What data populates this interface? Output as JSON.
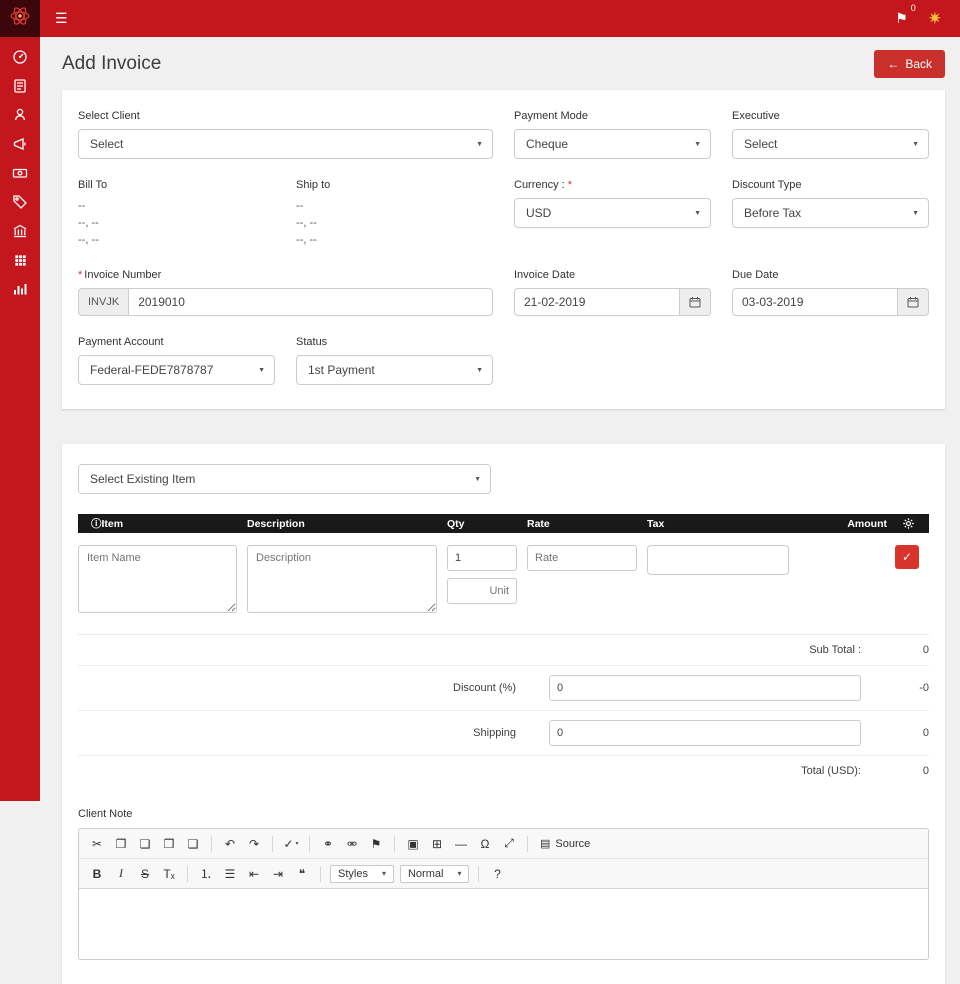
{
  "ui": {
    "caret": "▼"
  },
  "topbar": {
    "menu_icon": "☰",
    "flag_icon": "⚑",
    "flag_badge": "0",
    "star_icon": "✷"
  },
  "header": {
    "title": "Add Invoice",
    "back_arrow": "←",
    "back_label": "Back"
  },
  "invoice": {
    "required_mark": "*",
    "select_client_label": "Select Client",
    "select_client_value": "Select",
    "payment_mode_label": "Payment Mode",
    "payment_mode_value": "Cheque",
    "executive_label": "Executive",
    "executive_value": "Select",
    "bill_to_label": "Bill To",
    "bill_to_line1": "--",
    "bill_to_line2": "--, --",
    "bill_to_line3": "--, --",
    "ship_to_label": "Ship to",
    "ship_to_line1": "--",
    "ship_to_line2": "--, --",
    "ship_to_line3": "--, --",
    "currency_label": "Currency : ",
    "currency_value": "USD",
    "discount_type_label": "Discount Type",
    "discount_type_value": "Before Tax",
    "invoice_number_label": "Invoice Number",
    "invoice_number_prefix": "INVJK",
    "invoice_number_value": "2019010",
    "invoice_date_label": "Invoice Date",
    "invoice_date_value": "21-02-2019",
    "due_date_label": "Due Date",
    "due_date_value": "03-03-2019",
    "payment_account_label": "Payment Account",
    "payment_account_value": "Federal-FEDE7878787",
    "status_label": "Status",
    "status_value": "1st Payment"
  },
  "items": {
    "select_existing_value": "Select Existing Item",
    "info_icon": "ⓘ",
    "col_item": "Item",
    "col_description": "Description",
    "col_qty": "Qty",
    "col_rate": "Rate",
    "col_tax": "Tax",
    "col_amount": "Amount",
    "item_placeholder": "Item Name",
    "description_placeholder": "Description",
    "qty_value": "1",
    "unit_placeholder": "Unit",
    "rate_placeholder": "Rate",
    "add_check": "✓"
  },
  "totals": {
    "sub_total_label": "Sub Total :",
    "sub_total_value": "0",
    "discount_label": "Discount (%)",
    "discount_input": "0",
    "discount_value": "-0",
    "shipping_label": "Shipping",
    "shipping_input": "0",
    "shipping_value": "0",
    "total_label": "Total (USD):",
    "total_value": "0"
  },
  "note": {
    "label": "Client Note",
    "toolbar1": [
      "✂",
      "❐",
      "❏",
      "❒",
      "❑",
      "↶",
      "↷",
      "✓",
      "⚭",
      "⚮",
      "⚑",
      "▣",
      "⊞",
      "―",
      "Ω",
      "⤢"
    ],
    "caret": "▾",
    "source_icon": "▤",
    "source_label": "Source",
    "bold": "B",
    "italic": "I",
    "strike": "S",
    "remove_format": "Tₓ",
    "ol": "⒈",
    "ul": "☰",
    "outdent": "⇤",
    "indent": "⇥",
    "quote": "❝",
    "styles_label": "Styles",
    "format_label": "Normal",
    "about": "?"
  }
}
